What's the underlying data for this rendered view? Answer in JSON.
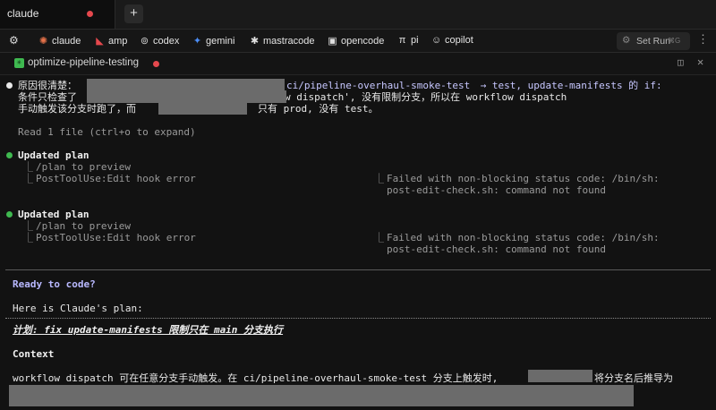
{
  "tabs": [
    {
      "label": "claude",
      "modified": true
    }
  ],
  "new_tab_symbol": "+",
  "agents": [
    {
      "label": "claude",
      "icon": "claude-icon",
      "glyph": "✺",
      "color": "#e8734a"
    },
    {
      "label": "amp",
      "icon": "amp-icon",
      "glyph": "◣",
      "color": "#e5484d"
    },
    {
      "label": "codex",
      "icon": "codex-icon",
      "glyph": "⊚",
      "color": "#cfcfcf"
    },
    {
      "label": "gemini",
      "icon": "gemini-icon",
      "glyph": "✦",
      "color": "#4c8df6"
    },
    {
      "label": "mastracode",
      "icon": "mastra-icon",
      "glyph": "✱",
      "color": "#e0e0e0"
    },
    {
      "label": "opencode",
      "icon": "opencode-icon",
      "glyph": "▣",
      "color": "#e0e0e0"
    },
    {
      "label": "pi",
      "icon": "pi-icon",
      "glyph": "π",
      "color": "#e0e0e0"
    },
    {
      "label": "copilot",
      "icon": "copilot-icon",
      "glyph": "☺",
      "color": "#e0e0e0"
    }
  ],
  "set_run": {
    "label": "Set Run",
    "shortcut": "⌘G"
  },
  "session": {
    "label": "optimize-pipeline-testing"
  },
  "terminal": {
    "l1_prefix": "原因很清楚：",
    "l1_branch": "ci/pipeline-overhaul-smoke-test",
    "l1_mid": " → test, update-manifests 的 if:",
    "l2_prefix": "条件只检查了",
    "l2_rest": "w dispatch', 没有限制分支，所以在 workflow dispatch",
    "l3_prefix": "手动触发该分支时跑了，而",
    "l3_rest": "只有 prod, 没有 test。",
    "read": "Read 1 file (ctrl+o to expand)",
    "block1": {
      "title": "Updated plan",
      "sub1": "/plan to preview",
      "sub2": "PostToolUse:Edit hook error",
      "err1": "Failed with non-blocking status code: /bin/sh:",
      "err2": "post-edit-check.sh: command not found"
    },
    "block2": {
      "title": "Updated plan",
      "sub1": "/plan to preview",
      "sub2": "PostToolUse:Edit hook error",
      "err1": "Failed with non-blocking status code: /bin/sh:",
      "err2": "post-edit-check.sh: command not found"
    },
    "ready": "Ready to code?",
    "here": "Here is Claude's plan:",
    "plan_title": "计划: fix update-manifests 限制只在 main 分支执行",
    "context": "Context",
    "ctx_line": "workflow dispatch 可在任意分支手动触发。在 ci/pipeline-overhaul-smoke-test 分支上触发时,",
    "ctx_line_end": "将分支名后推导为"
  }
}
